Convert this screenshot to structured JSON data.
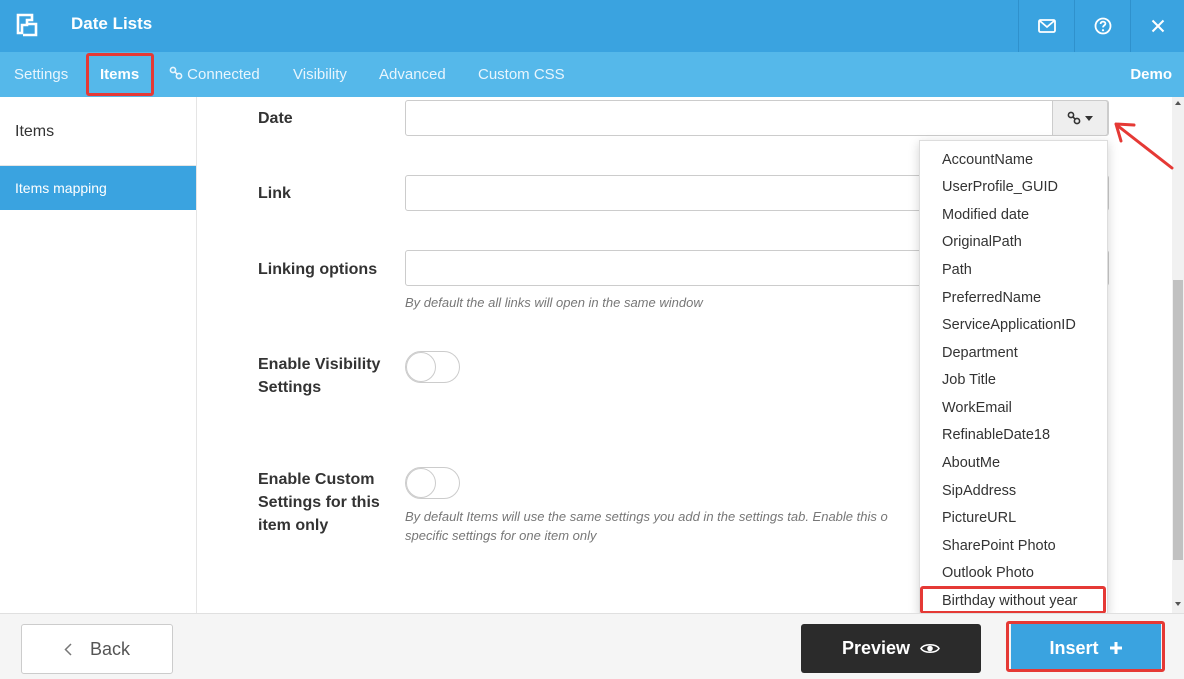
{
  "header": {
    "title": "Date Lists",
    "colors": {
      "bar": "#3aa3e0",
      "tabbar": "#55b8ea"
    },
    "icons": [
      "logo-icon",
      "mail-icon",
      "help-icon",
      "close-icon"
    ]
  },
  "tabs": {
    "settings": "Settings",
    "items": "Items",
    "connected": "Connected",
    "visibility": "Visibility",
    "advanced": "Advanced",
    "custom_css": "Custom CSS",
    "demo": "Demo",
    "active": "Items"
  },
  "sidebar": {
    "items": "Items",
    "items_mapping": "Items mapping"
  },
  "form": {
    "date_label": "Date",
    "link_label": "Link",
    "linking_options_label": "Linking options",
    "linking_hint": "By default the all links will open in the same window",
    "enable_visibility_label": "Enable Visibility Settings",
    "enable_custom_label": "Enable Custom Settings for this item only",
    "custom_hint": "By default Items will use the same settings you add in the settings tab. Enable this o specific settings for one item only"
  },
  "dropdown": {
    "options": [
      "AccountName",
      "UserProfile_GUID",
      "Modified date",
      "OriginalPath",
      "Path",
      "PreferredName",
      "ServiceApplicationID",
      "Department",
      "Job Title",
      "WorkEmail",
      "RefinableDate18",
      "AboutMe",
      "SipAddress",
      "PictureURL",
      "SharePoint Photo",
      "Outlook Photo",
      "Birthday without year"
    ],
    "highlighted": "Birthday without year"
  },
  "footer": {
    "back": "Back",
    "preview": "Preview",
    "insert": "Insert"
  },
  "annotation_color": "#e53935"
}
